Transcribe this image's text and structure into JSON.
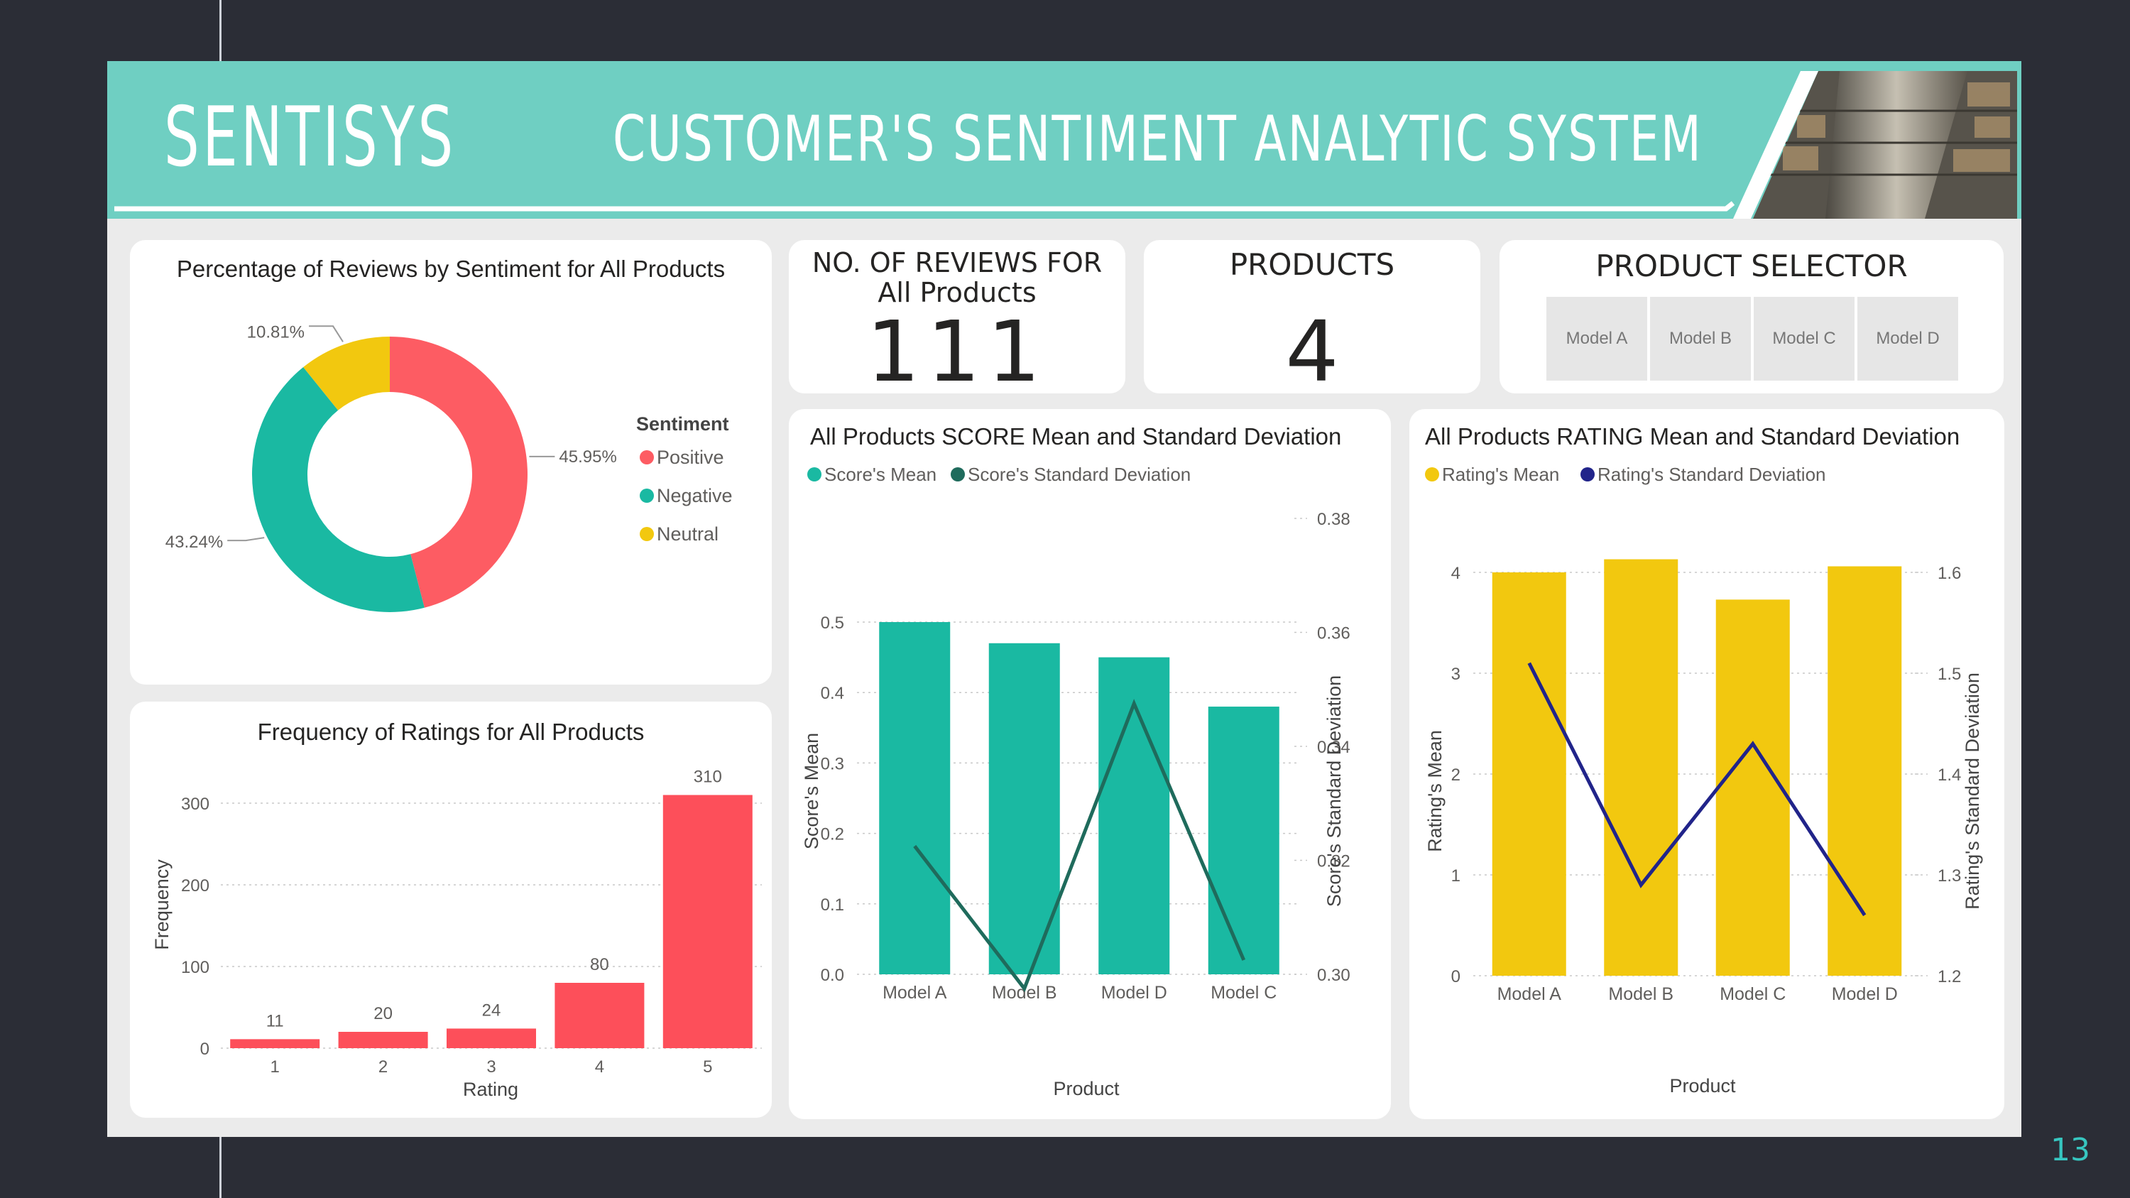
{
  "banner": {
    "brand": "SENTISYS",
    "subtitle": "CUSTOMER'S SENTIMENT ANALYTIC SYSTEM",
    "image_description_icon": "warehouse-photo"
  },
  "slide_number": "13",
  "kpi_reviews": {
    "title_line1": "NO. OF REVIEWS FOR",
    "title_line2": "All Products",
    "value": "111"
  },
  "kpi_products": {
    "title": "PRODUCTS",
    "value": "4"
  },
  "selector": {
    "title": "PRODUCT SELECTOR",
    "options": [
      "Model A",
      "Model B",
      "Model C",
      "Model D"
    ]
  },
  "colors": {
    "positive": "#fd5c63",
    "negative": "#1ab9a2",
    "neutral": "#f2c80f",
    "teal_bar": "#1ab9a2",
    "teal_line": "#1f6b5c",
    "yellow_bar": "#f2c80f",
    "navy_line": "#21248a",
    "red_bar": "#fd4f5a",
    "banner": "#6fcfc2"
  },
  "chart_data": [
    {
      "type": "pie",
      "variant": "donut",
      "title": "Percentage of Reviews by Sentiment for All Products",
      "legend_title": "Sentiment",
      "legend_position": "right",
      "categories": [
        "Positive",
        "Negative",
        "Neutral"
      ],
      "values": [
        45.95,
        43.24,
        10.81
      ],
      "labels": [
        "45.95%",
        "43.24%",
        "10.81%"
      ]
    },
    {
      "type": "bar",
      "title": "Frequency of Ratings for All Products",
      "xlabel": "Rating",
      "ylabel": "Frequency",
      "categories": [
        "1",
        "2",
        "3",
        "4",
        "5"
      ],
      "values": [
        11,
        20,
        24,
        80,
        310
      ],
      "ylim": [
        0,
        300
      ],
      "yticks": [
        "0",
        "100",
        "200",
        "300"
      ],
      "grid": true
    },
    {
      "type": "bar",
      "combo": "bar+line",
      "title": "All Products SCORE Mean and Standard Deviation",
      "xlabel": "Product",
      "ylabel": "Score's Mean",
      "y2label": "Score's Standard Deviation",
      "categories": [
        "Model A",
        "Model B",
        "Model D",
        "Model C"
      ],
      "series": [
        {
          "name": "Score's Mean",
          "values": [
            0.5,
            0.47,
            0.45,
            0.38
          ],
          "axis": "left",
          "kind": "bar"
        },
        {
          "name": "Score's Standard Deviation",
          "values": [
            0.3225,
            0.2975,
            0.3475,
            0.3025
          ],
          "axis": "right",
          "kind": "line"
        }
      ],
      "ylim": [
        0,
        0.5
      ],
      "yticks": [
        "0.0",
        "0.1",
        "0.2",
        "0.3",
        "0.4",
        "0.5"
      ],
      "y2lim": [
        0.3,
        0.38
      ],
      "y2ticks": [
        "0.30",
        "0.32",
        "0.34",
        "0.36",
        "0.38"
      ],
      "legend_position": "top-left"
    },
    {
      "type": "bar",
      "combo": "bar+line",
      "title": "All Products RATING Mean and Standard Deviation",
      "xlabel": "Product",
      "ylabel": "Rating's Mean",
      "y2label": "Rating's Standard Deviation",
      "categories": [
        "Model A",
        "Model B",
        "Model C",
        "Model D"
      ],
      "series": [
        {
          "name": "Rating's Mean",
          "values": [
            4.0,
            4.13,
            3.73,
            4.06
          ],
          "axis": "left",
          "kind": "bar"
        },
        {
          "name": "Rating's Standard Deviation",
          "values": [
            1.51,
            1.29,
            1.43,
            1.26
          ],
          "axis": "right",
          "kind": "line"
        }
      ],
      "ylim": [
        0,
        4
      ],
      "yticks": [
        "0",
        "1",
        "2",
        "3",
        "4"
      ],
      "y2lim": [
        1.2,
        1.6
      ],
      "y2ticks": [
        "1.2",
        "1.3",
        "1.4",
        "1.5",
        "1.6"
      ],
      "legend_position": "top-left"
    }
  ]
}
